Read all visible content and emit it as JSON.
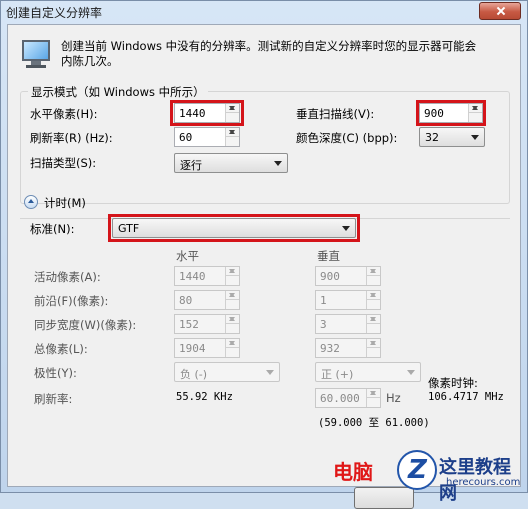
{
  "window": {
    "title": "创建自定义分辨率"
  },
  "intro": {
    "text": "创建当前 Windows 中没有的分辨率。测试新的自定义分辨率时您的显示器可能会内陈几次。"
  },
  "display_mode": {
    "group_label": "显示模式（如 Windows 中所示）",
    "h_pixels_label": "水平像素(H):",
    "h_pixels_value": "1440",
    "v_lines_label": "垂直扫描线(V):",
    "v_lines_value": "900",
    "refresh_label": "刷新率(R) (Hz):",
    "refresh_value": "60",
    "color_depth_label": "颜色深度(C) (bpp):",
    "color_depth_value": "32",
    "scan_type_label": "扫描类型(S):",
    "scan_type_value": "逐行"
  },
  "timing": {
    "toggle_label": "计时(M)",
    "standard_label": "标准(N):",
    "standard_value": "GTF",
    "col_horizontal": "水平",
    "col_vertical": "垂直",
    "rows": [
      {
        "label": "活动像素(A):",
        "h": "1440",
        "v": "900"
      },
      {
        "label": "前沿(F)(像素):",
        "h": "80",
        "v": "1"
      },
      {
        "label": "同步宽度(W)(像素):",
        "h": "152",
        "v": "3"
      },
      {
        "label": "总像素(L):",
        "h": "1904",
        "v": "932"
      }
    ],
    "polarity_label": "极性(Y):",
    "polarity_h": "负 (-)",
    "polarity_v": "正 (+)",
    "pixel_clock_label": "像素时钟:",
    "pixel_clock_value": "106.4717 MHz",
    "refresh_label": "刷新率:",
    "refresh_h": "55.92 KHz",
    "refresh_v": "60.000",
    "refresh_v_unit": "Hz",
    "refresh_range": "(59.000 至 61.000)"
  },
  "watermark": {
    "red_text": "电脑",
    "brand": "这里教程网",
    "url": "herecours.com"
  },
  "colors": {
    "highlight": "#d4141a",
    "client_bg": "#f0f0f0"
  }
}
